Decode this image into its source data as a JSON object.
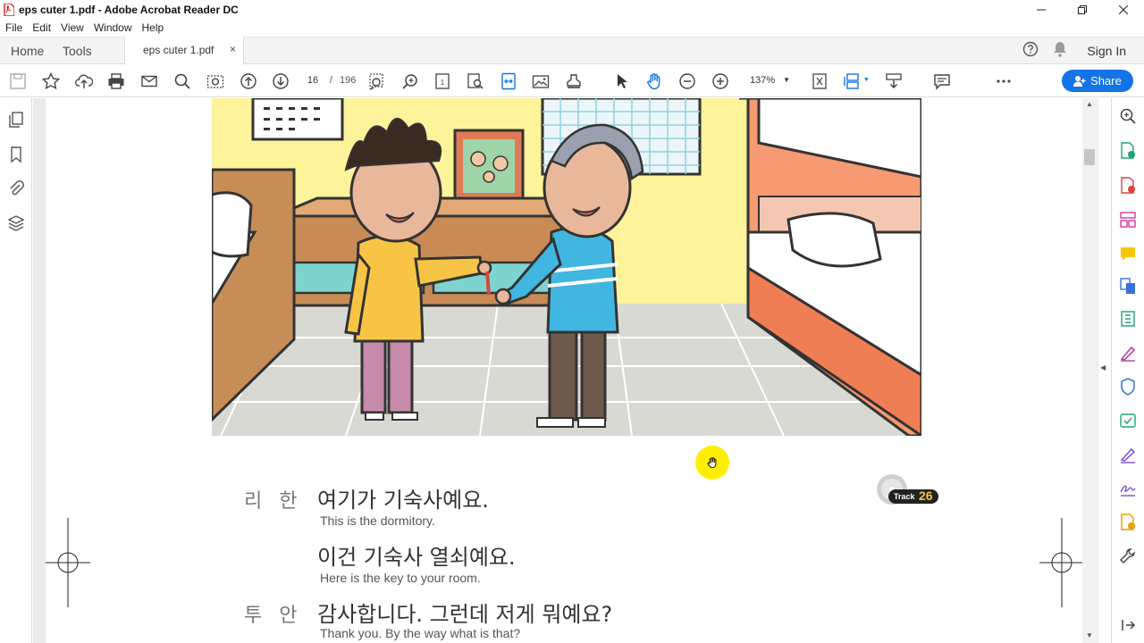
{
  "window": {
    "title": "eps cuter 1.pdf - Adobe Acrobat Reader DC",
    "controls": [
      "minimize",
      "restore",
      "close"
    ]
  },
  "menu": [
    "File",
    "Edit",
    "View",
    "Window",
    "Help"
  ],
  "tabs": {
    "home": "Home",
    "tools": "Tools",
    "document": "eps cuter 1.pdf",
    "close": "×"
  },
  "header_right": {
    "sign_in": "Sign In"
  },
  "toolbar": {
    "page_current": "16",
    "page_separator": "/",
    "page_total": "196",
    "zoom": "137%",
    "share": "Share"
  },
  "document": {
    "audio_badge": {
      "label": "Track",
      "number": "26"
    },
    "dialogue": [
      {
        "speaker": "리 한",
        "korean": "여기가 기숙사예요.",
        "english": "This is the dormitory."
      },
      {
        "speaker": "",
        "korean": "이건 기숙사 열쇠예요.",
        "english": "Here is the key to your room."
      },
      {
        "speaker": "투 안",
        "korean": "감사합니다. 그런데 저게 뭐예요?",
        "english": "Thank you. By the way what is that?"
      }
    ]
  },
  "colors": {
    "accent": "#1473e6",
    "cursor_highlight": "#ffee00",
    "wall": "#fcf39a",
    "floor": "#d8d8d2",
    "bed_frame": "#f59a72"
  },
  "icons": {
    "left_pane": [
      "pages-icon",
      "bookmark-icon",
      "attachment-icon",
      "layers-icon"
    ],
    "right_pane": [
      "search-zoom-icon",
      "export-pdf-icon",
      "create-pdf-icon",
      "organize-pages-icon",
      "comment-icon",
      "combine-files-icon",
      "compress-icon",
      "fill-sign-icon",
      "protect-icon",
      "send-review-icon",
      "request-signature-icon",
      "stamp-icon",
      "more-tools-icon",
      "wrench-icon",
      "expand-pane-icon"
    ]
  }
}
